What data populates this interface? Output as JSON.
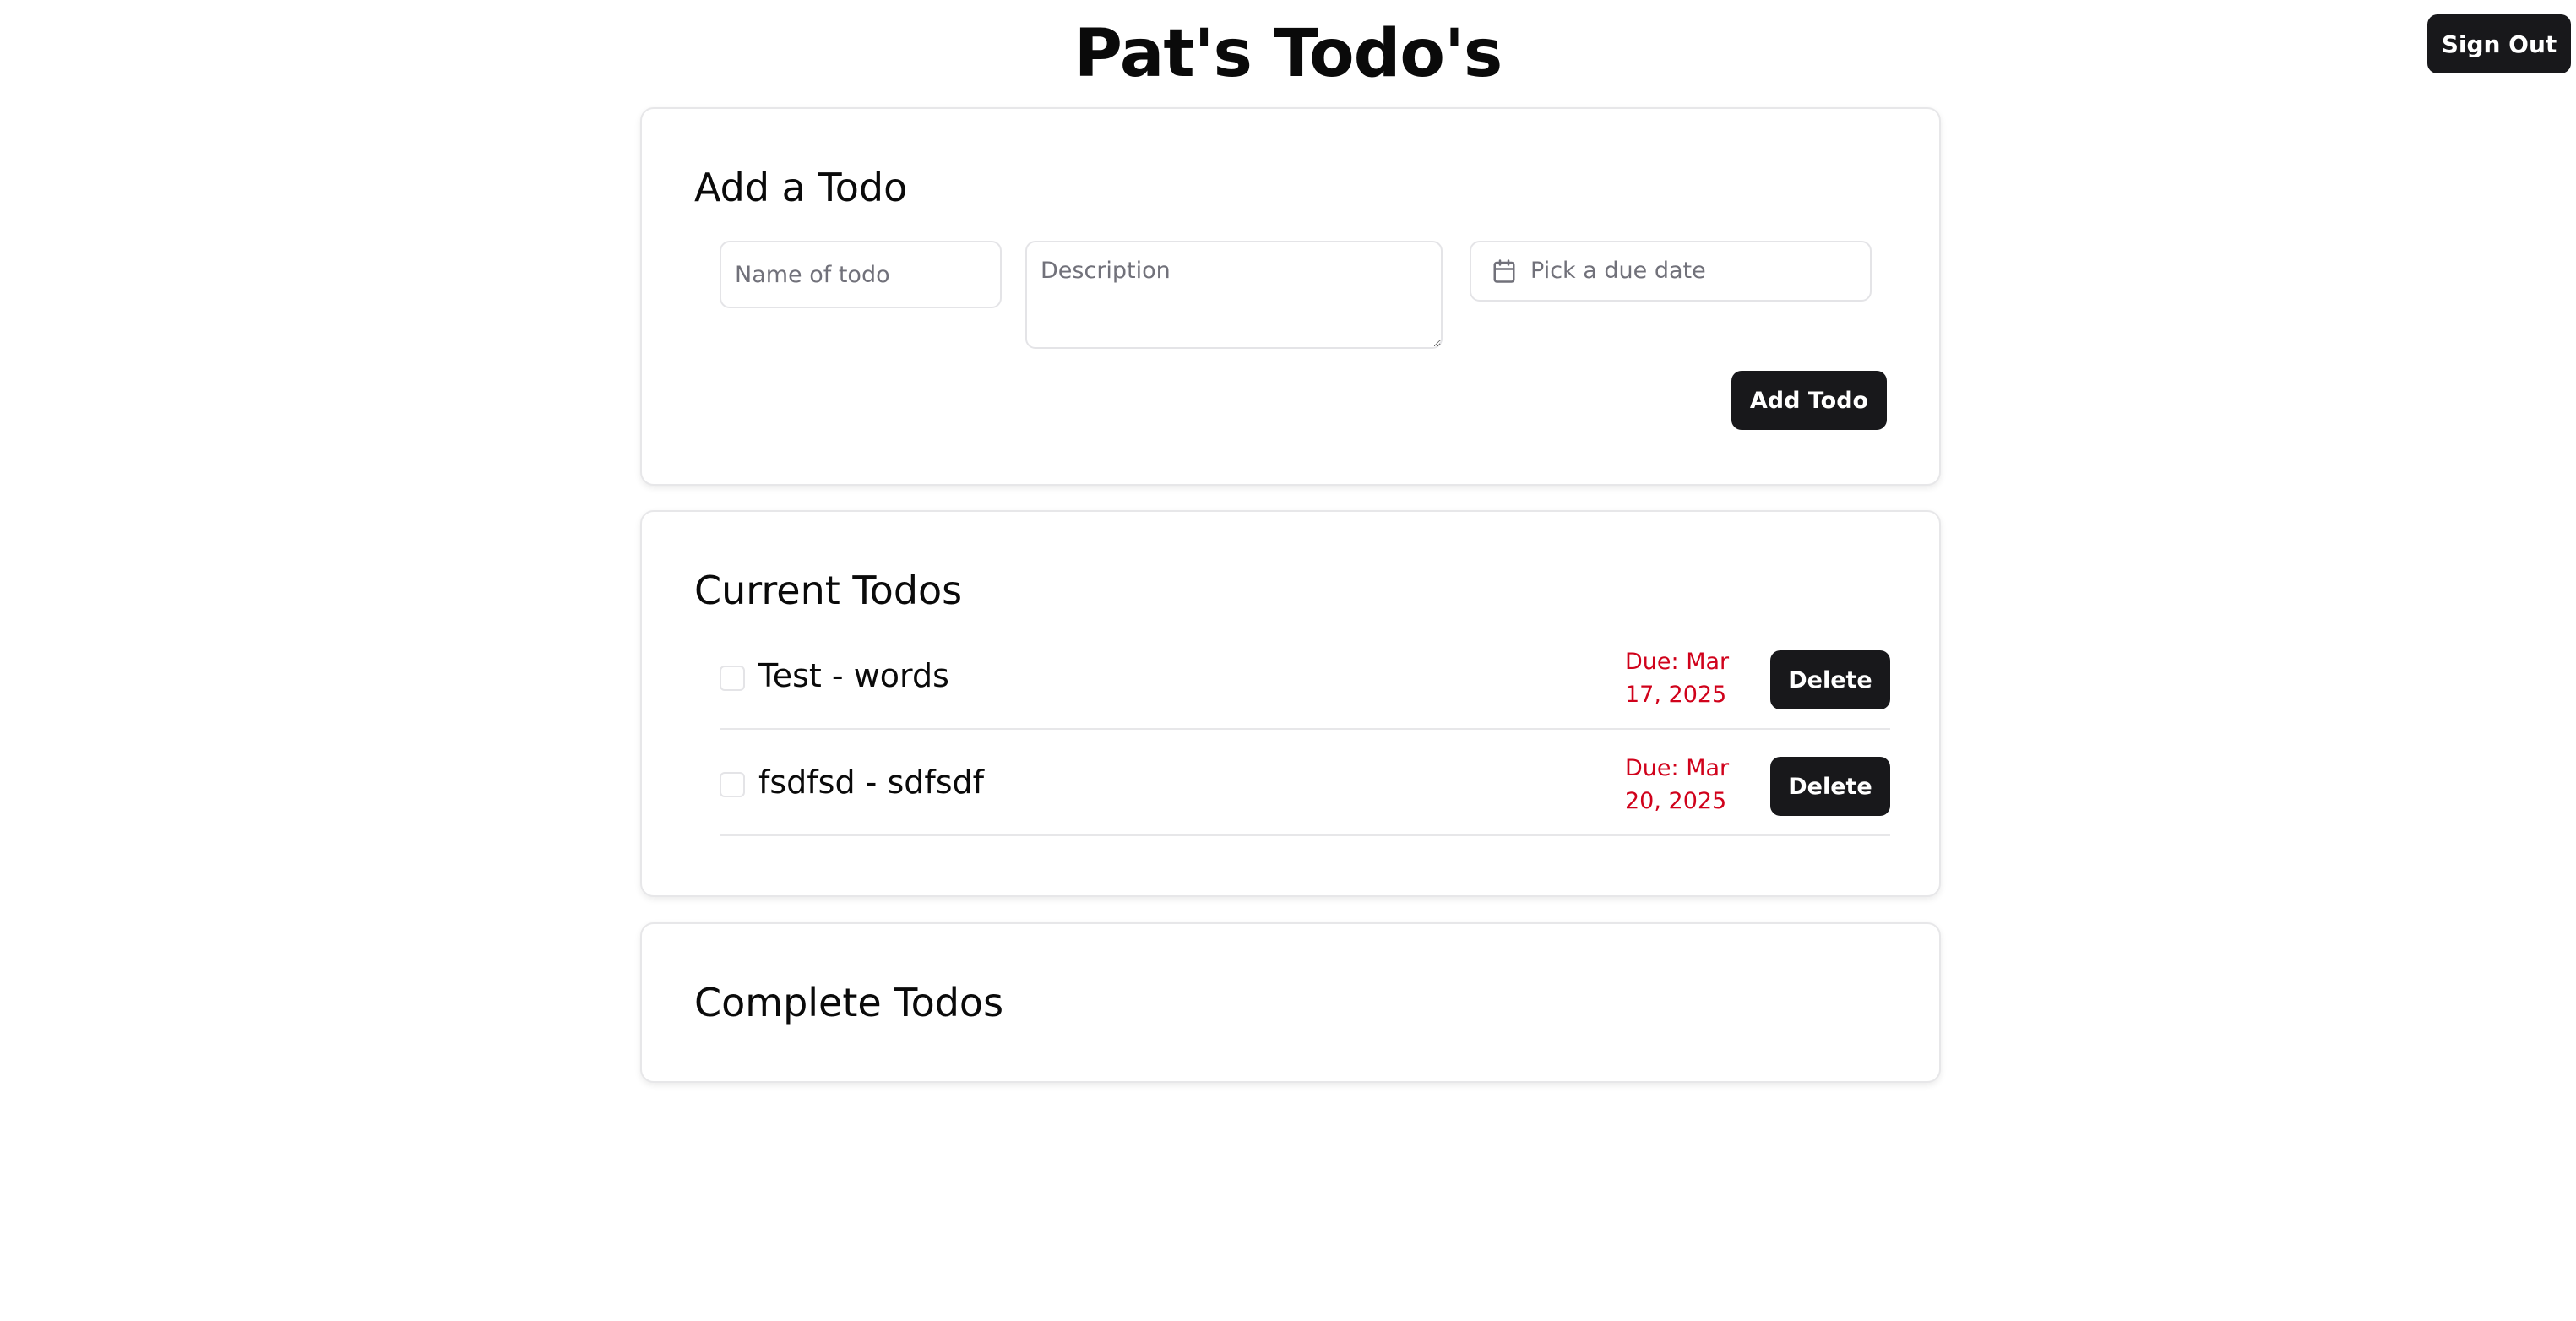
{
  "header": {
    "title": "Pat's Todo's",
    "sign_out_label": "Sign Out"
  },
  "add_todo": {
    "title": "Add a Todo",
    "name_placeholder": "Name of todo",
    "description_placeholder": "Description",
    "due_date_placeholder": "Pick a due date",
    "add_button_label": "Add Todo"
  },
  "current_todos": {
    "title": "Current Todos",
    "items": [
      {
        "text": "Test - words",
        "due": "Due: Mar 17, 2025",
        "delete_label": "Delete",
        "checked": false
      },
      {
        "text": "fsdfsd - sdfsdf",
        "due": "Due: Mar 20, 2025",
        "delete_label": "Delete",
        "checked": false
      }
    ]
  },
  "complete_todos": {
    "title": "Complete Todos"
  },
  "colors": {
    "primary_button": "#18181b",
    "due_text": "#d0021b",
    "border": "#e7e7e9"
  }
}
